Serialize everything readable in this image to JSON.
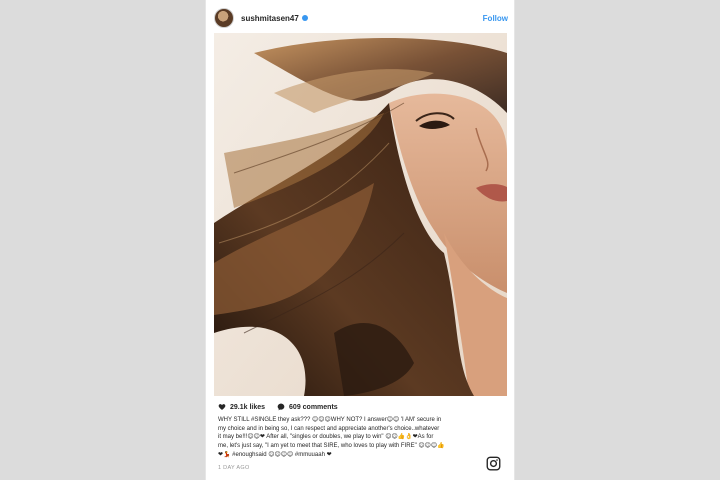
{
  "post": {
    "username": "sushmitasen47",
    "follow_label": "Follow",
    "likes": "29.1k likes",
    "comments": "609 comments",
    "caption_lines": [
      "WHY STILL #SINGLE they ask??? 😊😊😊WHY NOT? I answer😊😊 'I AM' secure in",
      "my choice and in being so, I can respect and appreciate another's choice..whatever",
      "it may be!!!😊😊❤ After all, \"singles or doubles, we play to win\" 😊😊👍👌❤As for",
      "me, let's just say, \"I am yet to meet that SIRE, who loves to play with FIRE\" 😊😊😊👍",
      "❤💃 #enoughsaid 😊😊😊😊 #mmuuaah ❤"
    ],
    "timestamp": "1 DAY AGO"
  },
  "icons": {
    "heart": "heart-icon",
    "comment": "comment-bubble-icon",
    "instagram": "instagram-logo-icon",
    "verified": "verified-badge-icon"
  },
  "colors": {
    "accent": "#3897f0",
    "heart": "#262626"
  }
}
